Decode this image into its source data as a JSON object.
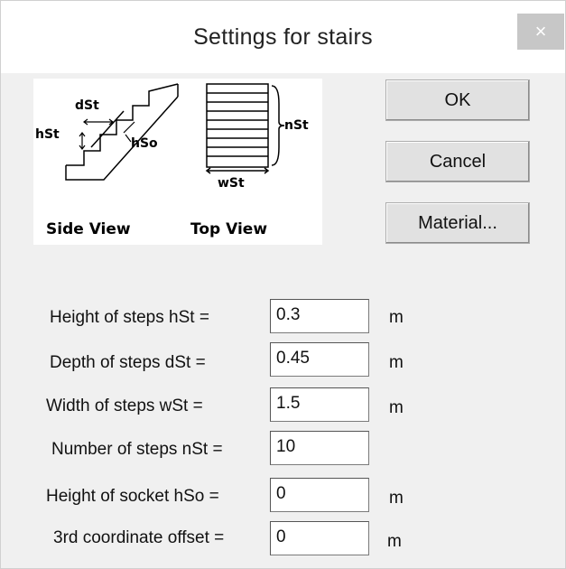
{
  "window": {
    "title": "Settings for stairs",
    "close_glyph": "×"
  },
  "illustration": {
    "side_view_label": "Side View",
    "top_view_label": "Top View",
    "labels": {
      "dst": "dSt",
      "hst": "hSt",
      "hso": "hSo",
      "nst": "nSt",
      "wst": "wSt"
    }
  },
  "buttons": {
    "ok": "OK",
    "cancel": "Cancel",
    "material": "Material..."
  },
  "fields": [
    {
      "label": "Height of steps  hSt =",
      "value": "0.3",
      "unit": "m"
    },
    {
      "label": "Depth of steps   dSt =",
      "value": "0.45",
      "unit": "m"
    },
    {
      "label": "Width of steps    wSt =",
      "value": "1.5",
      "unit": "m"
    },
    {
      "label": "Number of steps nSt =",
      "value": "10",
      "unit": ""
    },
    {
      "label": "Height of socket hSo =",
      "value": "0",
      "unit": "m"
    },
    {
      "label": "3rd coordinate offset =",
      "value": "0",
      "unit": "m"
    }
  ]
}
